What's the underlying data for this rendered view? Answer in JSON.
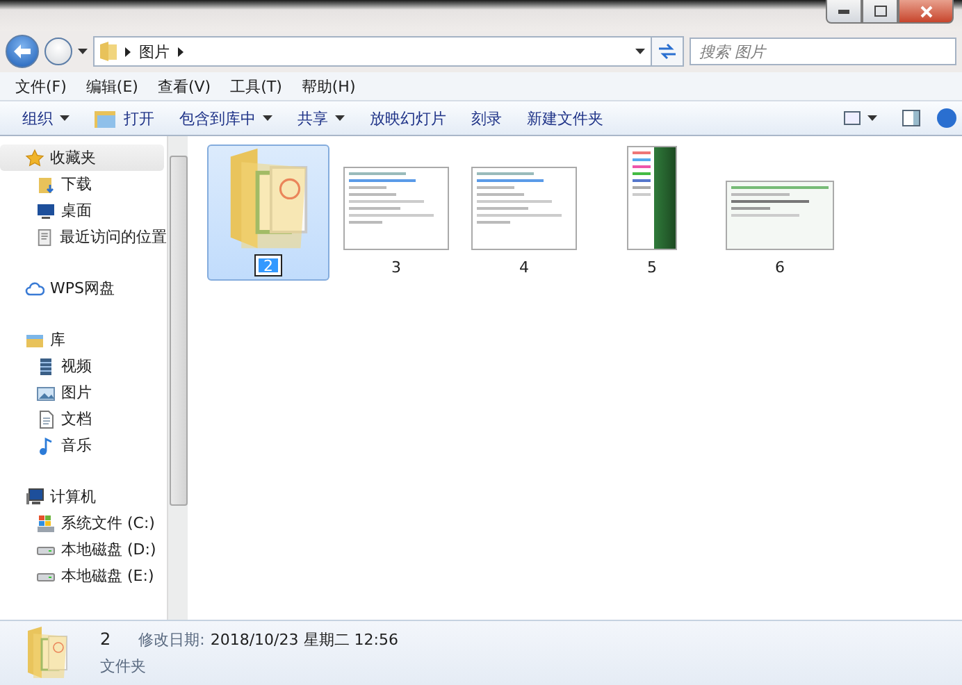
{
  "address": {
    "path": [
      "图片"
    ],
    "search_placeholder": "搜索 图片"
  },
  "menu": [
    "文件(F)",
    "编辑(E)",
    "查看(V)",
    "工具(T)",
    "帮助(H)"
  ],
  "toolbar": [
    {
      "label": "组织",
      "kind": "dropdown"
    },
    {
      "label": "打开",
      "kind": "open"
    },
    {
      "label": "包含到库中",
      "kind": "dropdown"
    },
    {
      "label": "共享",
      "kind": "dropdown"
    },
    {
      "label": "放映幻灯片",
      "kind": "plain"
    },
    {
      "label": "刻录",
      "kind": "plain"
    },
    {
      "label": "新建文件夹",
      "kind": "plain"
    }
  ],
  "nav": [
    {
      "label": "收藏夹",
      "kind": "favorites",
      "selected": true,
      "children": [
        {
          "label": "下载",
          "kind": "download"
        },
        {
          "label": "桌面",
          "kind": "desktop"
        },
        {
          "label": "最近访问的位置",
          "kind": "recent"
        }
      ]
    },
    {
      "label": "WPS网盘",
      "kind": "cloud",
      "selected": false
    },
    {
      "label": "库",
      "kind": "library",
      "selected": false,
      "children": [
        {
          "label": "视频",
          "kind": "video"
        },
        {
          "label": "图片",
          "kind": "pictures"
        },
        {
          "label": "文档",
          "kind": "documents"
        },
        {
          "label": "音乐",
          "kind": "music"
        }
      ]
    },
    {
      "label": "计算机",
      "kind": "computer",
      "selected": false,
      "children": [
        {
          "label": "系统文件 (C:)",
          "kind": "system-drive"
        },
        {
          "label": "本地磁盘 (D:)",
          "kind": "drive"
        },
        {
          "label": "本地磁盘 (E:)",
          "kind": "drive"
        }
      ]
    }
  ],
  "files": [
    {
      "name": "2",
      "kind": "folder",
      "selected": true,
      "renaming": true
    },
    {
      "name": "3",
      "kind": "dialog",
      "selected": false,
      "renaming": false
    },
    {
      "name": "4",
      "kind": "dialog",
      "selected": false,
      "renaming": false
    },
    {
      "name": "5",
      "kind": "menu",
      "selected": false,
      "renaming": false
    },
    {
      "name": "6",
      "kind": "window",
      "selected": false,
      "renaming": false
    }
  ],
  "details": {
    "name": "2",
    "type": "文件夹",
    "modified_label": "修改日期:",
    "modified": "2018/10/23 星期二 12:56"
  }
}
